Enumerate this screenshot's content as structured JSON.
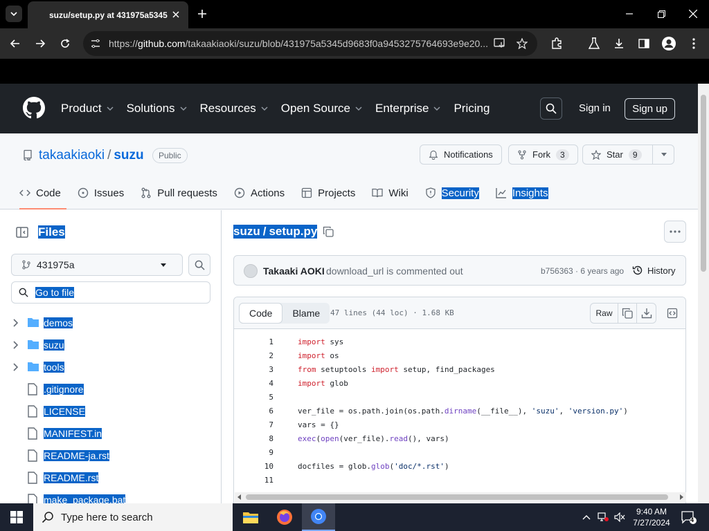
{
  "browser": {
    "tab_title": "suzu/setup.py at 431975a5345",
    "url_prefix": "https://",
    "url_host": "github.com",
    "url_path": "/takaakiaoki/suzu/blob/431975a5345d9683f0a9453275764693e9e20..."
  },
  "github": {
    "nav": [
      "Product",
      "Solutions",
      "Resources",
      "Open Source",
      "Enterprise",
      "Pricing"
    ],
    "sign_in": "Sign in",
    "sign_up": "Sign up"
  },
  "repo": {
    "owner": "takaakiaoki",
    "separator": "/",
    "name": "suzu",
    "visibility": "Public",
    "notifications_label": "Notifications",
    "fork_label": "Fork",
    "fork_count": "3",
    "star_label": "Star",
    "star_count": "9",
    "tabs": [
      "Code",
      "Issues",
      "Pull requests",
      "Actions",
      "Projects",
      "Wiki",
      "Security",
      "Insights"
    ]
  },
  "sidebar": {
    "title": "Files",
    "branch": "431975a",
    "goto_placeholder": "Go to file",
    "tree": [
      {
        "name": "demos",
        "type": "folder"
      },
      {
        "name": "suzu",
        "type": "folder"
      },
      {
        "name": "tools",
        "type": "folder"
      },
      {
        "name": ".gitignore",
        "type": "file"
      },
      {
        "name": "LICENSE",
        "type": "file"
      },
      {
        "name": "MANIFEST.in",
        "type": "file"
      },
      {
        "name": "README-ja.rst",
        "type": "file"
      },
      {
        "name": "README.rst",
        "type": "file"
      },
      {
        "name": "make_package.bat",
        "type": "file"
      }
    ]
  },
  "file": {
    "crumb_repo": "suzu",
    "crumb_sep": "/",
    "crumb_file": "setup.py",
    "commit_author": "Takaaki AOKI",
    "commit_message": "download_url is commented out",
    "commit_sha_age": "b756363 · 6 years ago",
    "history_label": "History",
    "view_code": "Code",
    "view_blame": "Blame",
    "info": "47 lines (44 loc) · 1.68 KB",
    "raw_label": "Raw",
    "line_numbers": [
      "1",
      "2",
      "3",
      "4",
      "5",
      "6",
      "7",
      "8",
      "9",
      "10",
      "11"
    ]
  },
  "taskbar": {
    "search_placeholder": "Type here to search",
    "time": "9:40 AM",
    "date": "7/27/2024",
    "notification_count": "4"
  },
  "colors": {
    "selection": "#0a64c8",
    "link": "#0969da",
    "header_bg": "#1f2328",
    "folder": "#54aeff"
  }
}
